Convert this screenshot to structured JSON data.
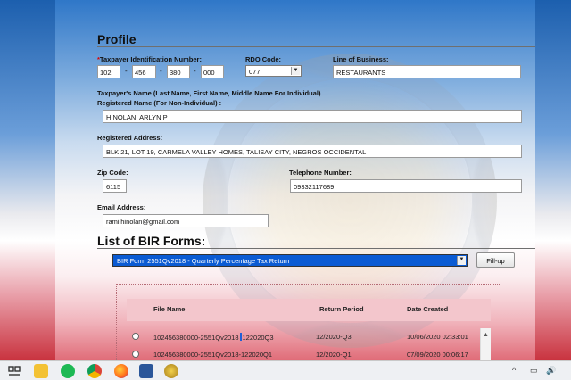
{
  "profile": {
    "title": "Profile",
    "tin": {
      "label": "Taxpayer Identification Number:",
      "required_mark": "*",
      "seg1": "102",
      "seg2": "456",
      "seg3": "380",
      "seg4": "000",
      "sep": "-"
    },
    "rdo": {
      "label": "RDO Code:",
      "value": "077"
    },
    "line_of_business": {
      "label": "Line of Business:",
      "value": "RESTAURANTS"
    },
    "taxpayer_name_label": "Taxpayer's Name (Last Name, First Name, Middle Name For Individual)",
    "registered_name": {
      "label": "Registered Name (For Non-Individual) :",
      "value": "HINOLAN, ARLYN P"
    },
    "registered_address": {
      "label": "Registered Address:",
      "value": "BLK 21, LOT 19, CARMELA VALLEY HOMES, TALISAY CITY, NEGROS OCCIDENTAL"
    },
    "zip": {
      "label": "Zip Code:",
      "value": "6115"
    },
    "telephone": {
      "label": "Telephone Number:",
      "value": "09332117689"
    },
    "email": {
      "label": "Email Address:",
      "value": "ramilhinolan@gmail.com"
    }
  },
  "forms": {
    "title": "List of BIR Forms:",
    "selected": "BIR Form 2551Qv2018 - Quarterly Percentage Tax Return",
    "fillup_label": "Fill-up"
  },
  "table": {
    "headers": {
      "file_name": "File Name",
      "return_period": "Return Period",
      "date_created": "Date Created"
    },
    "rows": [
      {
        "file_name_a": "102456380000-2551Qv2018",
        "file_name_b": "122020Q3",
        "return_period": "12/2020-Q3",
        "date_created": "10/06/2020 02:33:01"
      },
      {
        "file_name": "102456380000-2551Qv2018-122020Q1",
        "return_period": "12/2020-Q1",
        "date_created": "07/09/2020 00:06:17"
      }
    ]
  },
  "taskbar": {
    "icons": [
      "file-explorer-icon",
      "spotify-icon",
      "chrome-icon",
      "firefox-icon",
      "word-icon",
      "bir-efps-icon"
    ],
    "tray": {
      "chevron": "^",
      "battery": "▭",
      "volume": "🔊"
    }
  }
}
